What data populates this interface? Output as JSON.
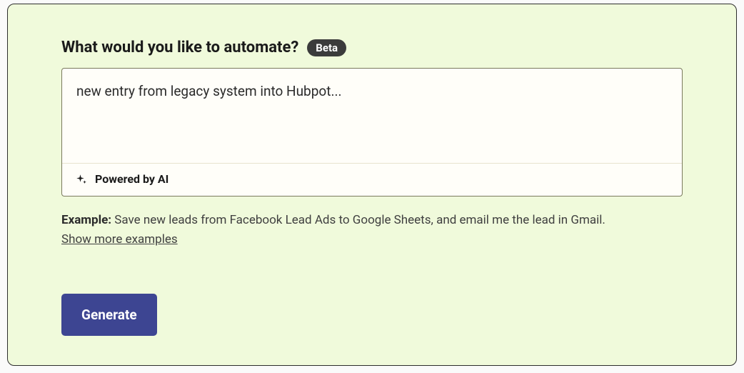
{
  "header": {
    "heading": "What would you like to automate?",
    "badge": "Beta"
  },
  "input": {
    "value": "new entry from legacy system into Hubpot...",
    "powered_label": "Powered by AI"
  },
  "example": {
    "label": "Example:",
    "text": " Save new leads from Facebook Lead Ads to Google Sheets, and email me the lead in Gmail.",
    "show_more": "Show more examples"
  },
  "actions": {
    "generate": "Generate"
  }
}
